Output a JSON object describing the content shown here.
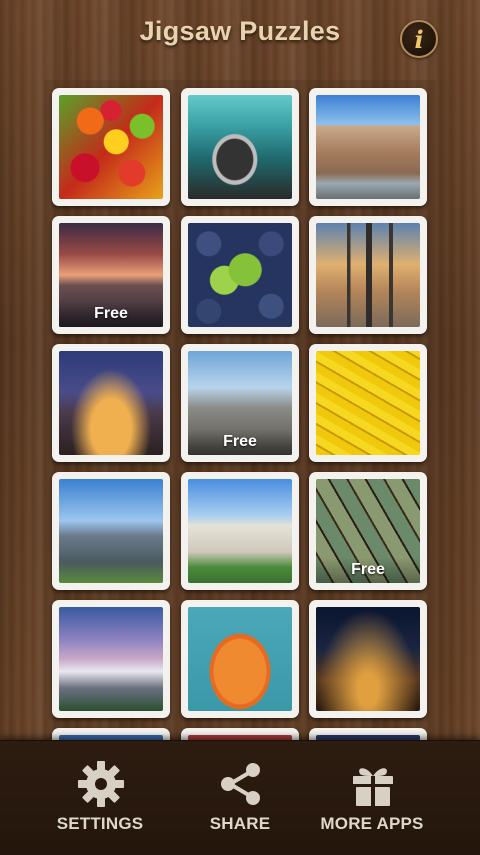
{
  "header": {
    "title": "Jigsaw Puzzles",
    "info_glyph": "i"
  },
  "puzzles": [
    {
      "icon": "fruit-image",
      "badge": ""
    },
    {
      "icon": "vintage-car-image",
      "badge": ""
    },
    {
      "icon": "amsterdam-image",
      "badge": ""
    },
    {
      "icon": "sunset-sea-image",
      "badge": "Free"
    },
    {
      "icon": "blueberries-image",
      "badge": ""
    },
    {
      "icon": "city-skyline-image",
      "badge": ""
    },
    {
      "icon": "paris-night-image",
      "badge": ""
    },
    {
      "icon": "church-town-image",
      "badge": "Free"
    },
    {
      "icon": "bananas-image",
      "badge": ""
    },
    {
      "icon": "modern-building-image",
      "badge": ""
    },
    {
      "icon": "rome-monument-image",
      "badge": ""
    },
    {
      "icon": "cracked-paint-image",
      "badge": "Free"
    },
    {
      "icon": "mountain-clouds-image",
      "badge": ""
    },
    {
      "icon": "lantern-flower-image",
      "badge": ""
    },
    {
      "icon": "night-city-image",
      "badge": ""
    }
  ],
  "bottom_nav": {
    "settings": "SETTINGS",
    "share": "SHARE",
    "more_apps": "MORE APPS"
  },
  "colors": {
    "title": "#e9d3ae",
    "wood": "#5a3820",
    "bar": "#2d1c10"
  }
}
